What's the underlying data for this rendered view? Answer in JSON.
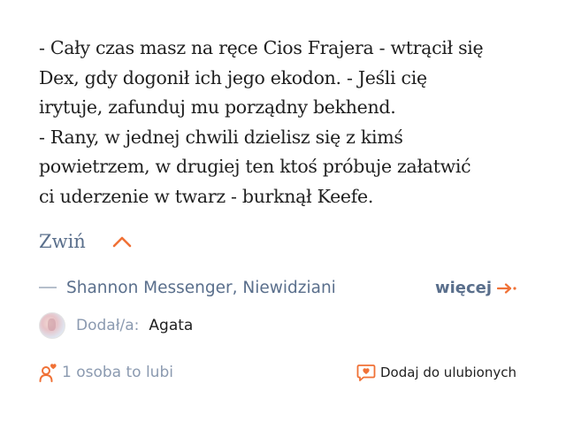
{
  "quote": {
    "lines": [
      "- Cały czas masz na ręce Cios Frajera - wtrącił się",
      "Dex, gdy dogonił ich jego ekodon. - Jeśli cię",
      "irytuje, zafunduj mu porządny bekhend.",
      "- Rany, w jednej chwili dzielisz się z kimś",
      "powietrzem, w drugiej ten ktoś próbuje załatwić",
      "ci uderzenie w twarz - burknął Keefe."
    ]
  },
  "collapse": {
    "label": "Zwiń",
    "icon": "chevron-up-icon"
  },
  "source": {
    "text": "Shannon Messenger, Niewidziani",
    "more_label": "więcej",
    "more_icon": "arrow-right-icon"
  },
  "added_by": {
    "label": "Dodał/a:",
    "user": "Agata",
    "avatar_icon": "avatar"
  },
  "footer": {
    "likes_text": "1 osoba to lubi",
    "likes_icon": "user-heart-icon",
    "favorite_label": "Dodaj do ulubionych",
    "favorite_icon": "heart-chat-icon"
  },
  "colors": {
    "accent": "#f07136",
    "muted_blue": "#5a6f8c",
    "gray_text": "#8b9ab0",
    "text": "#1f1f1f"
  }
}
